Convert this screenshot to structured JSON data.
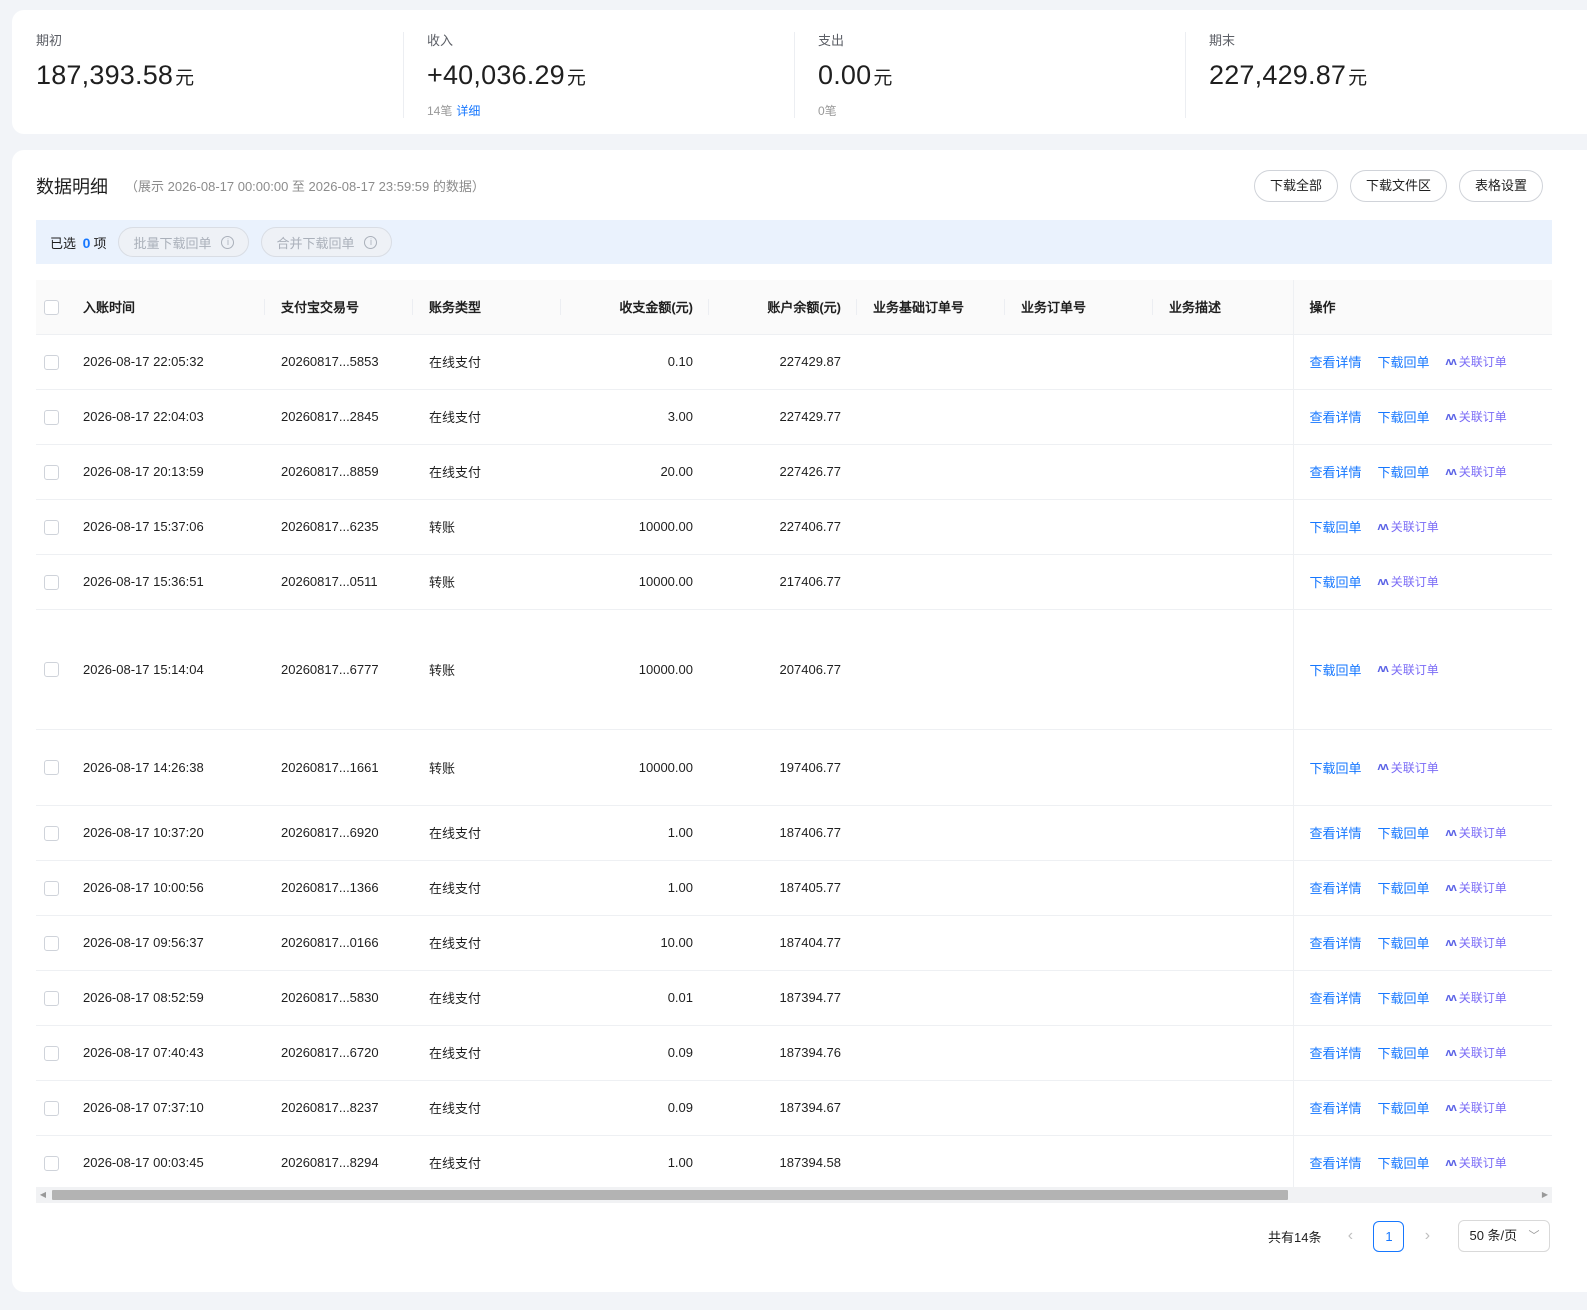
{
  "summary": [
    {
      "label": "期初",
      "value": "187,393.58",
      "unit": "元",
      "sub_count": "",
      "sub_link": ""
    },
    {
      "label": "收入",
      "value": "+40,036.29",
      "unit": "元",
      "sub_count": "14笔",
      "sub_link": "详细"
    },
    {
      "label": "支出",
      "value": "0.00",
      "unit": "元",
      "sub_count": "0笔",
      "sub_link": ""
    },
    {
      "label": "期末",
      "value": "227,429.87",
      "unit": "元",
      "sub_count": "",
      "sub_link": ""
    }
  ],
  "panel": {
    "title": "数据明细",
    "subtitle": "（展示 2026-08-17 00:00:00 至 2026-08-17 23:59:59 的数据）",
    "buttons": {
      "download_all": "下载全部",
      "download_files": "下载文件区",
      "table_settings": "表格设置"
    }
  },
  "selection": {
    "prefix": "已选",
    "count": "0",
    "suffix": "项",
    "batch_download": "批量下载回单",
    "merge_download": "合并下载回单"
  },
  "table": {
    "columns": {
      "time": "入账时间",
      "trade_no": "支付宝交易号",
      "type": "账务类型",
      "amount": "收支金额(元)",
      "balance": "账户余额(元)",
      "base_order": "业务基础订单号",
      "order": "业务订单号",
      "desc": "业务描述",
      "ops": "操作"
    },
    "actions": {
      "detail": "查看详情",
      "receipt": "下载回单",
      "link_order": "关联订单"
    },
    "rows": [
      {
        "time": "2026-08-17 22:05:32",
        "trade_no": "20260817...5853",
        "type": "在线支付",
        "amount": "0.10",
        "balance": "227429.87"
      },
      {
        "time": "2026-08-17 22:04:03",
        "trade_no": "20260817...2845",
        "type": "在线支付",
        "amount": "3.00",
        "balance": "227429.77"
      },
      {
        "time": "2026-08-17 20:13:59",
        "trade_no": "20260817...8859",
        "type": "在线支付",
        "amount": "20.00",
        "balance": "227426.77"
      },
      {
        "time": "2026-08-17 15:37:06",
        "trade_no": "20260817...6235",
        "type": "转账",
        "amount": "10000.00",
        "balance": "227406.77"
      },
      {
        "time": "2026-08-17 15:36:51",
        "trade_no": "20260817...0511",
        "type": "转账",
        "amount": "10000.00",
        "balance": "217406.77"
      },
      {
        "time": "2026-08-17 15:14:04",
        "trade_no": "20260817...6777",
        "type": "转账",
        "amount": "10000.00",
        "balance": "207406.77"
      },
      {
        "time": "2026-08-17 14:26:38",
        "trade_no": "20260817...1661",
        "type": "转账",
        "amount": "10000.00",
        "balance": "197406.77"
      },
      {
        "time": "2026-08-17 10:37:20",
        "trade_no": "20260817...6920",
        "type": "在线支付",
        "amount": "1.00",
        "balance": "187406.77"
      },
      {
        "time": "2026-08-17 10:00:56",
        "trade_no": "20260817...1366",
        "type": "在线支付",
        "amount": "1.00",
        "balance": "187405.77"
      },
      {
        "time": "2026-08-17 09:56:37",
        "trade_no": "20260817...0166",
        "type": "在线支付",
        "amount": "10.00",
        "balance": "187404.77"
      },
      {
        "time": "2026-08-17 08:52:59",
        "trade_no": "20260817...5830",
        "type": "在线支付",
        "amount": "0.01",
        "balance": "187394.77"
      },
      {
        "time": "2026-08-17 07:40:43",
        "trade_no": "20260817...6720",
        "type": "在线支付",
        "amount": "0.09",
        "balance": "187394.76"
      },
      {
        "time": "2026-08-17 07:37:10",
        "trade_no": "20260817...8237",
        "type": "在线支付",
        "amount": "0.09",
        "balance": "187394.67"
      },
      {
        "time": "2026-08-17 00:03:45",
        "trade_no": "20260817...8294",
        "type": "在线支付",
        "amount": "1.00",
        "balance": "187394.58"
      }
    ]
  },
  "pagination": {
    "total": "共有14条",
    "current": "1",
    "page_size": "50 条/页"
  },
  "colors": {
    "accent": "#1677ff",
    "ai_link": "#7b6cf6"
  },
  "icons": {
    "info": "info-circle-icon",
    "sort": "sort-icon",
    "ai": "ai-sparkle-icon",
    "prev": "chevron-left-icon",
    "next": "chevron-right-icon",
    "dropdown": "chevron-down-icon"
  }
}
